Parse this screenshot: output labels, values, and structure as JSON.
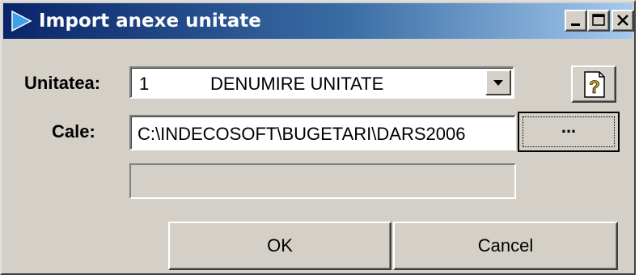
{
  "window": {
    "title": "Import anexe unitate",
    "accent_color": "#0a246a"
  },
  "form": {
    "unit_label": "Unitatea:",
    "unit_number": "1",
    "unit_name": "DENUMIRE UNITATE",
    "path_label": "Cale:",
    "path_value": "C:\\INDECOSOFT\\BUGETARI\\DARS2006",
    "browse_label": "..."
  },
  "buttons": {
    "ok": "OK",
    "cancel": "Cancel"
  },
  "icons": {
    "title": "play-arrow-icon",
    "minimize": "minimize-icon",
    "maximize": "maximize-icon",
    "close": "close-icon",
    "dropdown": "chevron-down-icon",
    "help": "help-document-icon"
  }
}
